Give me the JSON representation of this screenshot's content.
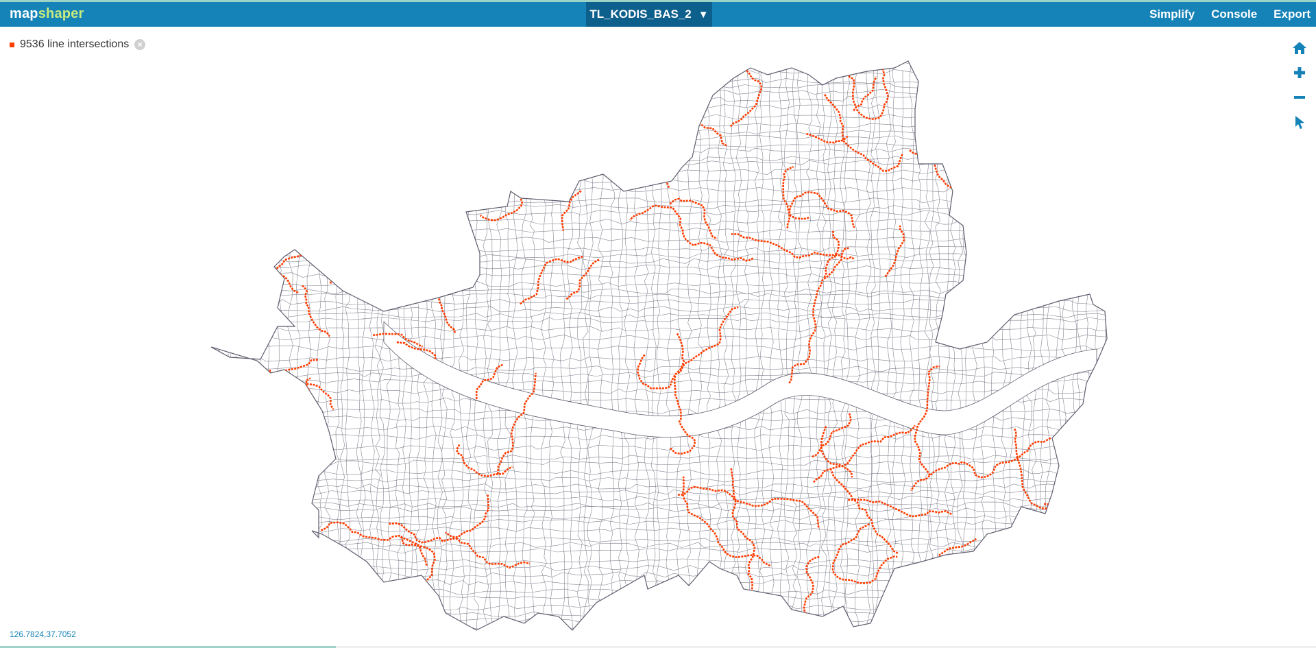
{
  "app": {
    "logo_part1": "map",
    "logo_part2": "shaper"
  },
  "layer": {
    "name": "TL_KODIS_BAS_2",
    "caret": "▼"
  },
  "menu": {
    "simplify": "Simplify",
    "console": "Console",
    "export": "Export"
  },
  "intersections": {
    "label": "9536 line intersections",
    "close": "×"
  },
  "tools": [
    "home-icon",
    "zoom-in-icon",
    "zoom-out-icon",
    "pointer-icon"
  ],
  "coordinates": "126.7824,37.7052",
  "colors": {
    "topbar": "#1583b8",
    "layer_button": "#0d5f8c",
    "intersection": "#ff3c00",
    "outline": "#5c5c6e",
    "logo_accent": "#c9ec7e"
  }
}
